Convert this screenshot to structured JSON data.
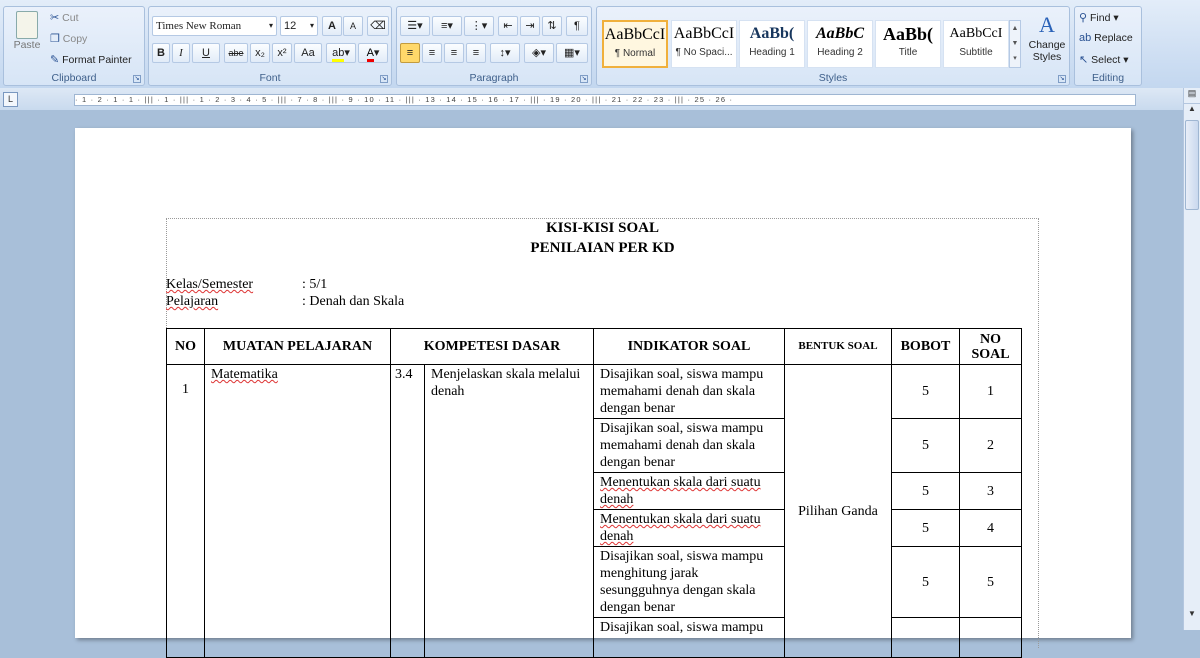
{
  "clipboard": {
    "paste": "Paste",
    "cut": "Cut",
    "copy": "Copy",
    "format_painter": "Format Painter",
    "label": "Clipboard"
  },
  "font": {
    "family": "Times New Roman",
    "size": "12",
    "label": "Font",
    "buttons": [
      "B",
      "I",
      "U",
      "abe",
      "x₂",
      "x²",
      "Aa"
    ]
  },
  "paragraph": {
    "label": "Paragraph"
  },
  "styles": {
    "label": "Styles",
    "items": [
      {
        "sample": "AaBbCcI",
        "name": "¶ Normal"
      },
      {
        "sample": "AaBbCcI",
        "name": "¶ No Spaci..."
      },
      {
        "sample": "AaBb(",
        "name": "Heading 1"
      },
      {
        "sample": "AaBbC",
        "name": "Heading 2"
      },
      {
        "sample": "AaBb(",
        "name": "Title"
      },
      {
        "sample": "AaBbCcI",
        "name": "Subtitle"
      }
    ],
    "change_styles": "Change Styles"
  },
  "editing": {
    "find": "Find",
    "replace": "Replace",
    "select": "Select",
    "label": "Editing"
  },
  "ruler": {
    "text": "· 1 · 2 · 1 · 1 · ||| · 1 · ||| · 1 · 2 · 3 · 4 · 5 · ||| · 7 · 8 · ||| · 9 · 10 · 11 · ||| · 13 · 14 · 15 · 16 · 17 · ||| · 19 · 20 · ||| · 21 · 22 · 23 · ||| · 25 · 26 ·"
  },
  "doc": {
    "title1": "KISI-KISI SOAL",
    "title2": "PENILAIAN PER KD",
    "kelas_label": "Kelas/Semester",
    "kelas_value": ": 5/1",
    "pelajaran_label": "Pelajaran",
    "pelajaran_value": ": Denah dan Skala",
    "headers": [
      "NO",
      "MUATAN PELAJARAN",
      "KOMPETESI DASAR",
      "INDIKATOR SOAL",
      "BENTUK SOAL",
      "BOBOT",
      "NO SOAL"
    ],
    "no": "1",
    "muatan": "Matematika",
    "kd_no": "3.4",
    "kd_text": "Menjelaskan skala melalui denah",
    "bentuk": "Pilihan Ganda",
    "rows": [
      {
        "indikator": "Disajikan soal, siswa mampu memahami denah dan skala dengan benar",
        "bobot": "5",
        "no_soal": "1"
      },
      {
        "indikator": "Disajikan soal, siswa mampu memahami denah dan skala dengan benar",
        "bobot": "5",
        "no_soal": "2"
      },
      {
        "indikator": "Menentukan skala dari suatu denah",
        "bobot": "5",
        "no_soal": "3"
      },
      {
        "indikator": "Menentukan skala dari suatu denah",
        "bobot": "5",
        "no_soal": "4"
      },
      {
        "indikator": "Disajikan soal, siswa mampu menghitung jarak sesungguhnya dengan skala dengan benar",
        "bobot": "5",
        "no_soal": "5"
      },
      {
        "indikator": "Disajikan soal, siswa mampu",
        "bobot": "",
        "no_soal": ""
      }
    ]
  }
}
